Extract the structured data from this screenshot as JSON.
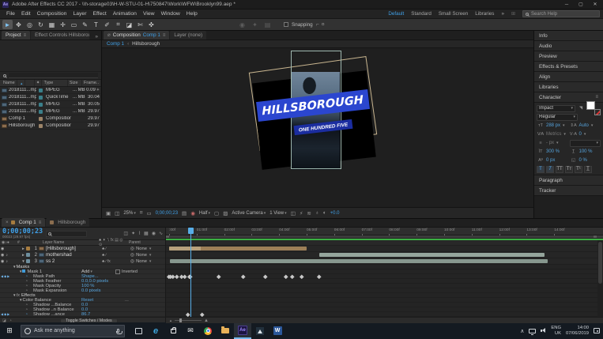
{
  "colors": {
    "accent_blue": "#3fa0e8",
    "value_blue": "#55a3dc",
    "banner_blue": "#2b46cf",
    "banner_dark_blue": "#1b2da0",
    "render_bar_green": "#3cb043",
    "layer_bar_tan": "#9c7f57",
    "layer_bar_tan_light": "#b7a17c",
    "layer_bar_gray_green": "#95a59c",
    "layer_bar_gray_green_dark": "#87978e",
    "playhead_blue": "#58aee8"
  },
  "titlebar": {
    "app_badge": "Ae",
    "title": "Adobe After Effects CC 2017 - \\\\h-storage03\\H-W-STU-01-H\\750847\\Work\\WFW\\Brooklyn99.aep *",
    "minimize": "─",
    "maximize": "▢",
    "close": "✕"
  },
  "menubar": {
    "items": [
      "File",
      "Edit",
      "Composition",
      "Layer",
      "Effect",
      "Animation",
      "View",
      "Window",
      "Help"
    ]
  },
  "workspaces": {
    "items": [
      {
        "label": "Default",
        "active": true
      },
      {
        "label": "Standard",
        "active": false
      },
      {
        "label": "Small Screen",
        "active": false
      },
      {
        "label": "Libraries",
        "active": false
      }
    ],
    "overflow": "»",
    "search_placeholder": "Search Help"
  },
  "toolbar": {
    "tools": [
      {
        "name": "selection-tool",
        "glyph": "►",
        "active": true
      },
      {
        "name": "hand-tool",
        "glyph": "✥",
        "active": false
      },
      {
        "name": "zoom-tool",
        "glyph": "◎",
        "active": false
      },
      {
        "name": "rotation-tool",
        "glyph": "↻",
        "active": false
      },
      {
        "name": "unified-camera-tool",
        "glyph": "▦",
        "active": false
      },
      {
        "name": "pan-behind-tool",
        "glyph": "✛",
        "active": false
      },
      {
        "name": "shape-tool",
        "glyph": "▭",
        "active": false
      },
      {
        "name": "pen-tool",
        "glyph": "✎",
        "active": false
      },
      {
        "name": "type-tool",
        "glyph": "T",
        "active": false
      },
      {
        "name": "brush-tool",
        "glyph": "✐",
        "active": false
      },
      {
        "name": "clone-stamp-tool",
        "glyph": "⌗",
        "active": false
      },
      {
        "name": "eraser-tool",
        "glyph": "◪",
        "active": false
      },
      {
        "name": "roto-brush-tool",
        "glyph": "✄",
        "active": false
      },
      {
        "name": "puppet-pin-tool",
        "glyph": "✜",
        "active": false
      }
    ],
    "disabled_tools": [
      "◉",
      "✦",
      "▤"
    ],
    "snapping_label": "Snapping",
    "snapping_option_glyphs": [
      "⌐",
      "¤"
    ]
  },
  "project": {
    "tabs": [
      {
        "label": "Project",
        "active": true
      },
      {
        "label": "Effect Controls Hillsborough",
        "active": false
      }
    ],
    "overflow": "»",
    "columns": [
      "Name",
      "Type",
      "Size",
      "Frame.."
    ],
    "sort_glyph": "▲",
    "fav_glyph": "✦",
    "rows": [
      {
        "name": "2018111...mp4",
        "kind": "footage",
        "type": "MPEG",
        "size": "... MB",
        "fps": "30.09",
        "badge": "✳"
      },
      {
        "name": "2018111...mp4",
        "kind": "footage",
        "type": "QuickTime",
        "size": "... MB",
        "fps": "30.04",
        "badge": ""
      },
      {
        "name": "2018111...mp4",
        "kind": "footage",
        "type": "MPEG",
        "size": "... MB",
        "fps": "30.05",
        "badge": ""
      },
      {
        "name": "2018111...mp4",
        "kind": "footage",
        "type": "MPEG",
        "size": "... MB",
        "fps": "29.97",
        "badge": ""
      },
      {
        "name": "Comp 1",
        "kind": "comp",
        "type": "Composition",
        "size": "",
        "fps": "29.97",
        "badge": ""
      },
      {
        "name": "Hillsborough",
        "kind": "comp",
        "type": "Composition",
        "size": "",
        "fps": "29.97",
        "badge": ""
      }
    ]
  },
  "viewer": {
    "tabs": [
      {
        "prefix": "Composition",
        "label": "Comp 1",
        "active": true
      },
      {
        "prefix": "",
        "label": "Layer (none)",
        "active": false
      }
    ],
    "navigator": {
      "current": "Comp 1",
      "separator": "‹",
      "parent": "Hillsborough"
    },
    "card": {
      "title": "HILLSBOROUGH",
      "subtitle": "ONE HUNDRED FIVE"
    },
    "toolbar": {
      "zoom": "25%",
      "timecode": "0;00;00;23",
      "resolution": "Half",
      "camera": "Active Camera",
      "views": "1 View",
      "exposure": "+0.0"
    }
  },
  "dock": {
    "panels_top": [
      "Info",
      "Audio",
      "Preview",
      "Effects & Presets",
      "Align",
      "Libraries"
    ],
    "character": {
      "title": "Character",
      "font": "Impact",
      "style": "Regular",
      "size": "288 px",
      "leading": "Auto",
      "kerning": "Metrics",
      "tracking": "0",
      "baseline_units": "- px",
      "vertical_scale": "300 %",
      "horizontal_scale": "100 %",
      "baseline_shift": "0 px",
      "tsume": "0 %",
      "style_buttons": [
        "T",
        "T",
        "TT",
        "Tт",
        "T¹",
        "T̲"
      ]
    },
    "panels_bottom": [
      "Paragraph",
      "Tracker"
    ]
  },
  "timeline": {
    "tabs": [
      {
        "label": "Comp 1",
        "active": true
      },
      {
        "label": "Hillsborough",
        "active": false
      }
    ],
    "timecode": "0;00;00;23",
    "timecode_sub": "00023 (29.97 fps)",
    "header": {
      "layer_name": "Layer Name",
      "parent": "Parent",
      "switch_glyphs": "♣ ✦ ∖ fx ▤ ◎ ⊙"
    },
    "layers": [
      {
        "num": "1",
        "name": "[Hillsborough]",
        "kind": "comp",
        "eye": true,
        "audio": false,
        "twirl": "►",
        "switches": "♣  ∕",
        "parent": "None",
        "bar": {
          "in": 0,
          "out": 5.0,
          "color": "#9c7f57",
          "light_out": 1.15,
          "light_color": "#b7a17c"
        }
      },
      {
        "num": "2",
        "name": "mothershad",
        "kind": "footage",
        "eye": true,
        "audio": true,
        "twirl": "►",
        "switches": "♣  ∕",
        "parent": "None",
        "bar": {
          "in": 5.45,
          "out": 13.66,
          "color": "#95a59c"
        }
      },
      {
        "num": "3",
        "name": "ss 2",
        "kind": "footage",
        "eye": true,
        "audio": true,
        "twirl": "▼",
        "switches": "♣  ∕ fx",
        "parent": "None",
        "bar": {
          "in": 0.03,
          "out": 13.76,
          "color": "#87978e"
        }
      }
    ],
    "props": [
      {
        "row": "group",
        "label": "Masks"
      },
      {
        "row": "mask",
        "label": "Mask 1",
        "mode": "Add",
        "inverted_label": "Inverted"
      },
      {
        "row": "prop",
        "label": "Mask Path",
        "value": "Shape...",
        "nav": true,
        "keyframed": true,
        "keys": [
          0,
          0.06,
          0.15,
          0.29,
          0.44,
          0.58,
          0.73,
          0.78,
          1.81,
          2.7,
          3.49,
          4.26,
          4.48,
          4.81,
          5.44
        ]
      },
      {
        "row": "prop",
        "label": "Mask Feather",
        "value": "0.0,0.0 pixels",
        "keyframed": false
      },
      {
        "row": "prop",
        "label": "Mask Opacity",
        "value": "100 %",
        "keyframed": false
      },
      {
        "row": "prop",
        "label": "Mask Expansion",
        "value": "0.0 pixels",
        "keyframed": false
      },
      {
        "row": "group",
        "label": "Effects",
        "fx": true
      },
      {
        "row": "effect",
        "label": "Color Balance",
        "value": "Reset",
        "more": "..."
      },
      {
        "row": "prop",
        "label": "Shadow ...Balance",
        "value": "0.0",
        "keyframed": false
      },
      {
        "row": "prop",
        "label": "Shadow ..n Balance",
        "value": "0.0",
        "keyframed": false
      },
      {
        "row": "prop",
        "label": "Shadow ...ance",
        "value": "86.7",
        "nav": true,
        "keyframed": true,
        "keys": [
          0.69,
          1.21
        ]
      }
    ],
    "ruler_ticks": [
      ":00f",
      "01:00f",
      "02:00f",
      "03:00f",
      "04:00f",
      "05:00f",
      "06:00f",
      "07:00f",
      "08:00f",
      "09:00f",
      "10:00f",
      "11:00f",
      "12:00f",
      "13:00f",
      "14:00f"
    ],
    "playhead_seconds": 0.77,
    "toggle_label": "Toggle Switches / Modes"
  },
  "taskbar": {
    "search_placeholder": "Ask me anything",
    "apps": [
      {
        "name": "task-view",
        "active": false
      },
      {
        "name": "edge",
        "active": false
      },
      {
        "name": "store",
        "active": false
      },
      {
        "name": "mail",
        "active": false
      },
      {
        "name": "chrome",
        "active": false
      },
      {
        "name": "file-explorer",
        "active": false
      },
      {
        "name": "after-effects",
        "active": true
      },
      {
        "name": "photos",
        "active": false
      },
      {
        "name": "word",
        "active": false
      }
    ],
    "tray": {
      "lang_line1": "ENG",
      "lang_line2": "UK",
      "time": "14:00",
      "date": "07/06/2019"
    }
  }
}
